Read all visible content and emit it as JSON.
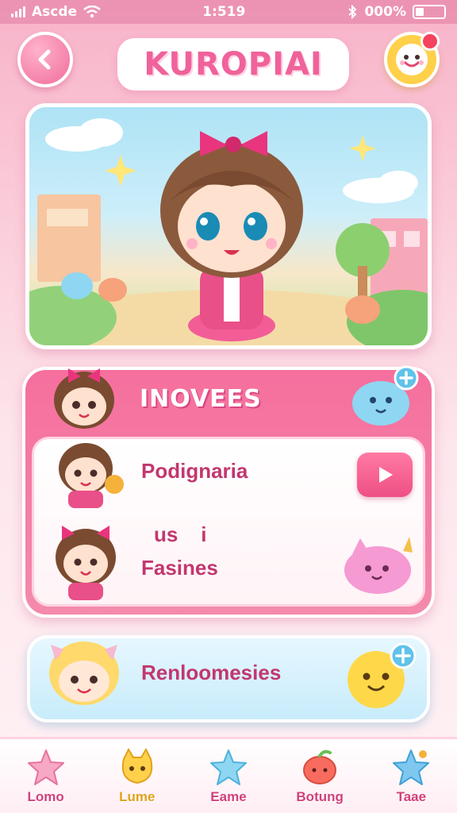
{
  "status_bar": {
    "carrier": "Ascde",
    "time": "1:519",
    "battery": "000%"
  },
  "header": {
    "title": "KUROРIAI",
    "back_icon": "chevron-left-icon",
    "profile_icon": "smiley-face-icon"
  },
  "hero": {
    "scene": "chibi-girl-hero-illustration"
  },
  "news": {
    "title": "INOVEES",
    "rows": [
      {
        "label": "Podignaria"
      },
      {
        "label": "us    i"
      },
      {
        "label": "Fasines"
      }
    ]
  },
  "recommendation": {
    "label": "Renloomesies"
  },
  "bottom_nav": {
    "items": [
      {
        "label": "Lomo",
        "icon": "star-icon"
      },
      {
        "label": "Lume",
        "icon": "cat-icon"
      },
      {
        "label": "Eame",
        "icon": "star-icon"
      },
      {
        "label": "Botung",
        "icon": "apple-icon"
      },
      {
        "label": "Taae",
        "icon": "star-icon"
      }
    ]
  },
  "colors": {
    "primary_pink": "#f06d9c",
    "accent_yellow": "#ffd04a",
    "accent_blue": "#8fd6f2"
  }
}
